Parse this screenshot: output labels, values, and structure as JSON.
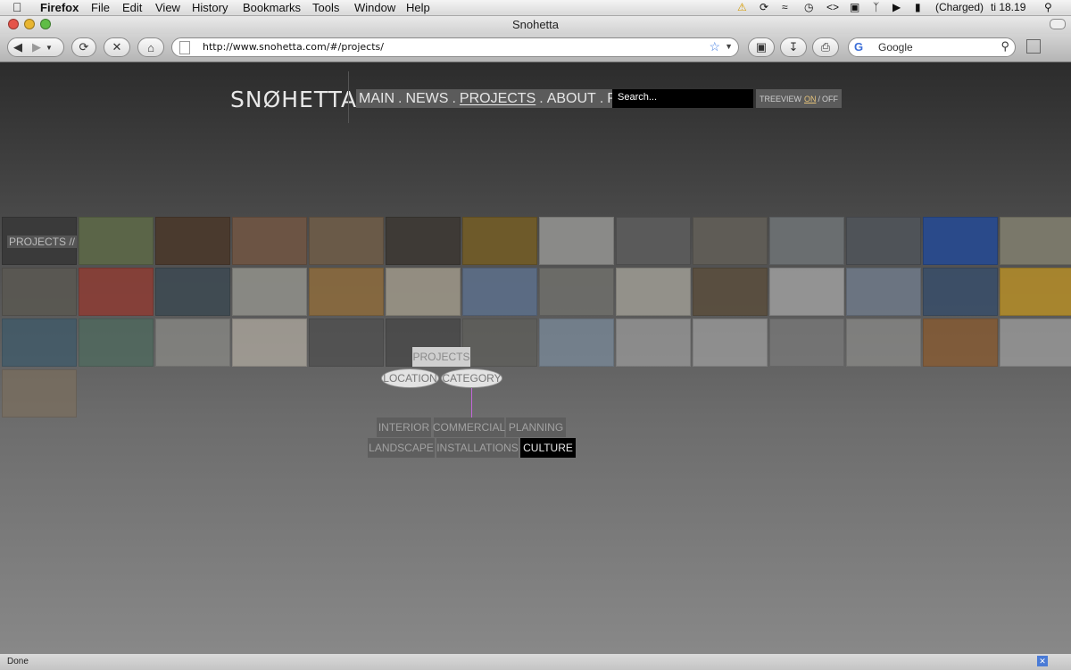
{
  "menubar": {
    "app_name": "Firefox",
    "items": [
      "File",
      "Edit",
      "View",
      "History",
      "Bookmarks",
      "Tools",
      "Window",
      "Help"
    ],
    "battery": "(Charged)",
    "clock": "ti 18.19"
  },
  "browser": {
    "window_title": "Snohetta",
    "url": "http://www.snohetta.com/#/projects/",
    "search_placeholder": "Google",
    "status": "Done"
  },
  "site": {
    "logo": "SNØHETTA",
    "nav": [
      {
        "label": "MAIN",
        "active": false
      },
      {
        "label": "NEWS",
        "active": false
      },
      {
        "label": "PROJECTS",
        "active": true
      },
      {
        "label": "ABOUT",
        "active": false
      },
      {
        "label": "PRESS",
        "active": false
      }
    ],
    "nav_separator": ".",
    "search_placeholder": "Search...",
    "treeview": {
      "label": "TREEVIEW",
      "on": "ON",
      "divider": "/",
      "off": "OFF"
    }
  },
  "projects_label": "PROJECTS //",
  "tiles": [
    [
      "#3a3a3a",
      "#5b6548",
      "#4a3a2e",
      "#6c5444",
      "#6a5a48",
      "#3e3a36",
      "#6e5a2a",
      "#8a8a88",
      "#5a5a5a",
      "#5f5c56",
      "#6a6e70",
      "#4f5358",
      "#2a4a8a",
      "#7a786a"
    ],
    [
      "#5a5852",
      "#8a3e36",
      "#3e4a52",
      "#8e8e88",
      "#8a6a3e",
      "#9a9486",
      "#5c6e88",
      "#6e6e6a",
      "#9a9890",
      "#5a4e3e",
      "#9a9a9a",
      "#6e7886",
      "#3a4e68",
      "#b08a2a"
    ],
    [
      "#3e5a6a",
      "#4e6a5e",
      "#8a8a86",
      "#b0aaa0",
      "#4e4e4e",
      "#464646",
      "#5e5e5a",
      "#7a8a9a",
      "#9a9a9a",
      "#9e9e9e",
      "#7a7a7a",
      "#8a8a88",
      "#8a5a2e",
      "#9e9e9e"
    ],
    [
      "#7a6e5e"
    ]
  ],
  "tree": {
    "root": "PROJECTS",
    "level1": [
      "LOCATION",
      "CATEGORY"
    ],
    "categories_row1": [
      "INTERIOR",
      "COMMERCIAL",
      "PLANNING"
    ],
    "categories_row2": [
      "LANDSCAPE",
      "INSTALLATIONS",
      "CULTURE"
    ],
    "selected": "CULTURE"
  },
  "colors": {
    "tree_link": "#c267d8",
    "selected_bg": "#000000",
    "treeview_on": "#e6c37a"
  }
}
